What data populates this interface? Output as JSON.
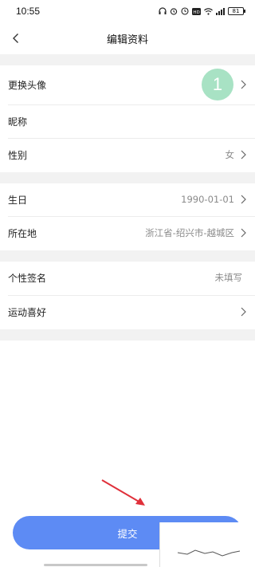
{
  "status_bar": {
    "time": "10:55",
    "icons": [
      "headphones-icon",
      "alarm-icon",
      "clock-icon",
      "hd-icon",
      "wifi-icon",
      "signal-icon"
    ],
    "battery": "81"
  },
  "nav": {
    "title": "编辑资料",
    "back_icon": "chevron-left-icon"
  },
  "group1": {
    "avatar": {
      "label": "更换头像",
      "avatar_text": "1",
      "avatar_color": "#a8e2c4"
    },
    "nickname": {
      "label": "昵称",
      "value": ""
    },
    "gender": {
      "label": "性别",
      "value": "女"
    }
  },
  "group2": {
    "birthday": {
      "label": "生日",
      "value": "1990-01-01"
    },
    "location": {
      "label": "所在地",
      "value": "浙江省-绍兴市-越城区"
    }
  },
  "group3": {
    "signature": {
      "label": "个性签名",
      "value": "未填写"
    },
    "sports": {
      "label": "运动喜好",
      "value": ""
    }
  },
  "submit": {
    "label": "提交",
    "color": "#5d8bf4"
  },
  "annotation_color": "#e0303a"
}
